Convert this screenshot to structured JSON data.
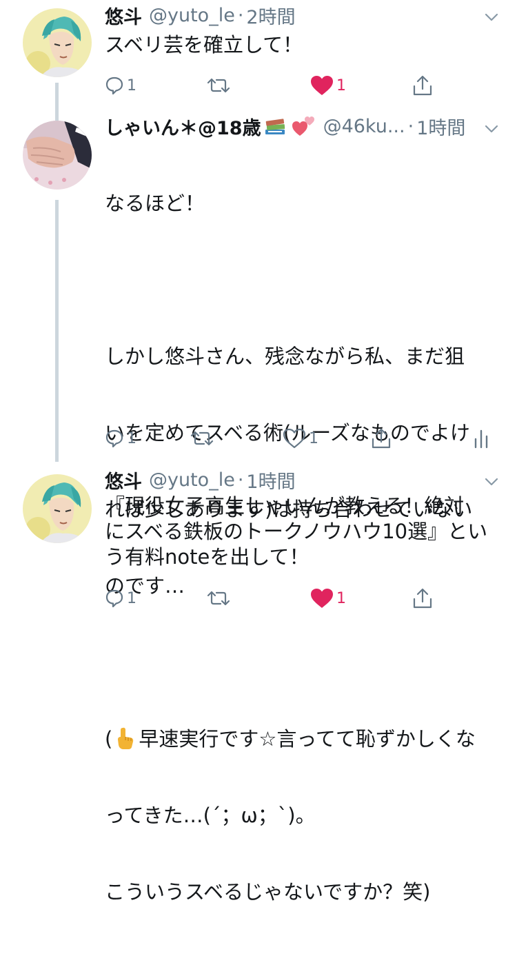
{
  "tweets": [
    {
      "name": "悠斗",
      "handle": "@yuto_le",
      "dot": "·",
      "time": "2時間",
      "text": "スベリ芸を確立して！",
      "replies": "1",
      "likes": "1",
      "liked": true,
      "avatar_icon": "avatar-anime-character"
    },
    {
      "name": "しゃいん＊@18歳",
      "handle": "@46ku...",
      "dot": "·",
      "time": "1時間",
      "text_lines": [
        "なるほど！",
        "",
        "しかし悠斗さん、残念ながら私、まだ狙",
        "いを定めてスベる術(ルーズなものでよけ",
        "れば少しあります)は持ち合わせていない",
        "のです…",
        "",
        "(",
        "早速実行です☆言ってて恥ずかしくな",
        "ってきた…(´；ω；`)。",
        "こういうスベるじゃないですか？笑)"
      ],
      "replies": "1",
      "likes": "1",
      "liked": false,
      "avatar_icon": "avatar-photo-hand"
    },
    {
      "name": "悠斗",
      "handle": "@yuto_le",
      "dot": "·",
      "time": "1時間",
      "text": "『現役女子高生しゃいんが教える！絶対\nにスベる鉄板のトークノウハウ10選』とい\nう有料noteを出して！",
      "replies": "1",
      "likes": "1",
      "liked": true,
      "avatar_icon": "avatar-anime-character"
    }
  ],
  "colors": {
    "text": "#14171a",
    "muted": "#657786",
    "like": "#e0245e",
    "thread": "#ccd6dd"
  },
  "icons": [
    "reply-icon",
    "retweet-icon",
    "heart-icon",
    "share-icon",
    "analytics-icon",
    "chevron-down-icon",
    "books-emoji-icon",
    "hearts-emoji-icon",
    "pointing-hand-emoji-icon"
  ]
}
